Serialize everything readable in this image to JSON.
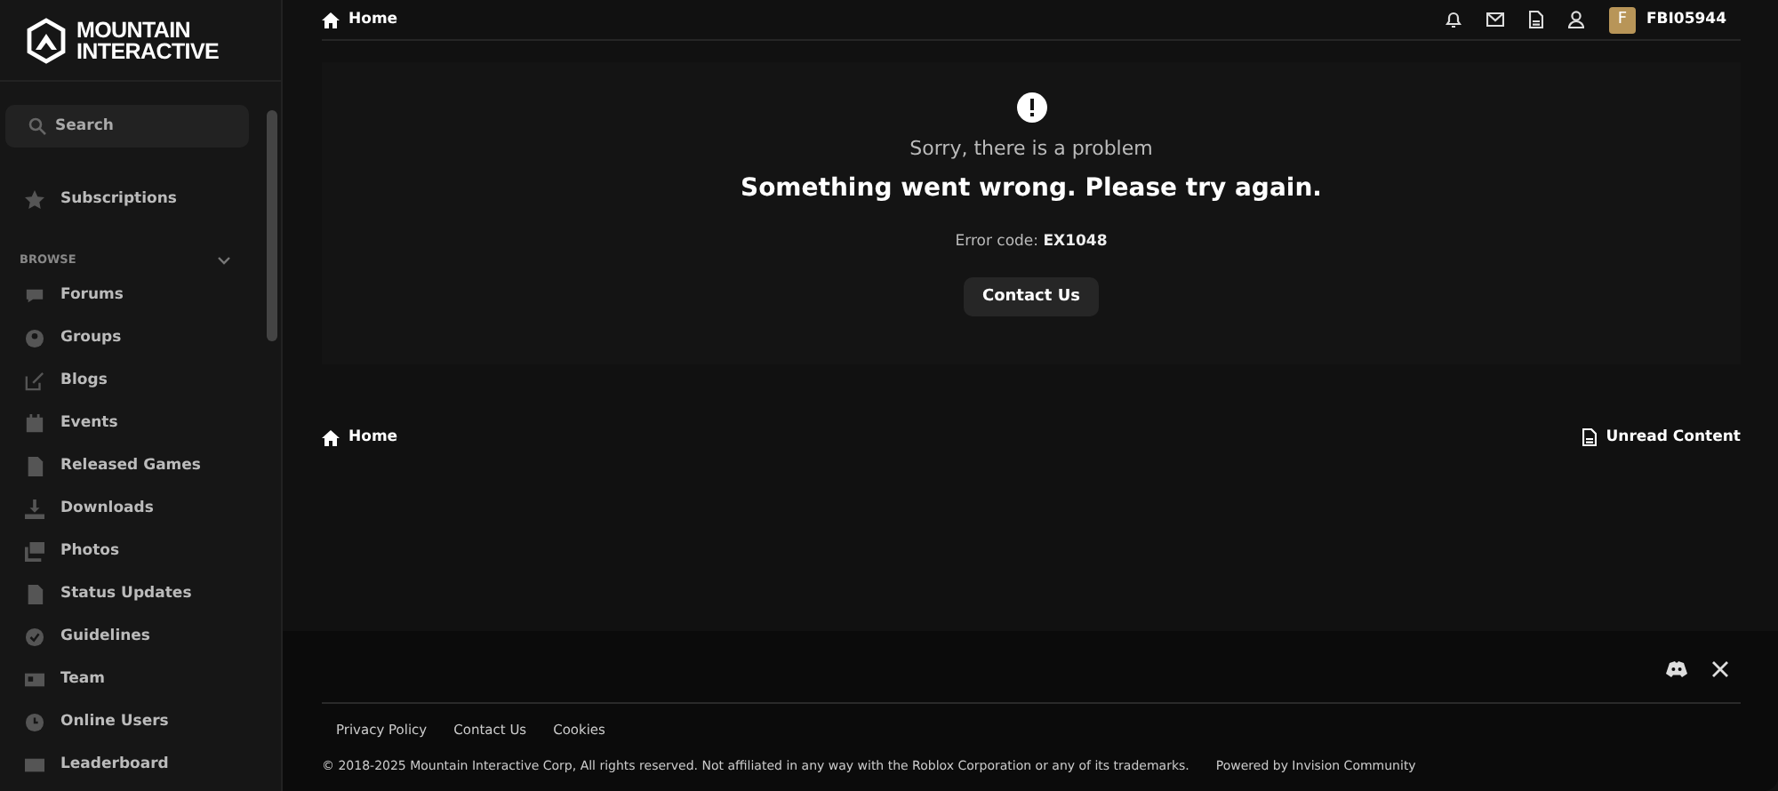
{
  "brand": {
    "line1": "MOUNTAIN",
    "line2": "INTERACTIVE"
  },
  "sidebar": {
    "search": {
      "placeholder": "Search"
    },
    "subscriptions": "Subscriptions",
    "section": {
      "title": "BROWSE",
      "expanded": true
    },
    "items": [
      {
        "label": "Forums"
      },
      {
        "label": "Groups"
      },
      {
        "label": "Blogs"
      },
      {
        "label": "Events"
      },
      {
        "label": "Released Games"
      },
      {
        "label": "Downloads"
      },
      {
        "label": "Photos"
      },
      {
        "label": "Status Updates"
      },
      {
        "label": "Guidelines"
      },
      {
        "label": "Team"
      },
      {
        "label": "Online Users"
      },
      {
        "label": "Leaderboard"
      }
    ]
  },
  "top_bar": {
    "breadcrumb": "Home",
    "avatar_letter": "F",
    "username": "FBI05944"
  },
  "error": {
    "subtitle": "Sorry, there is a problem",
    "title": "Something went wrong. Please try again.",
    "code_label": "Error code:",
    "code": "EX1048",
    "button": "Contact Us"
  },
  "bottom_bar": {
    "breadcrumb": "Home",
    "unread": "Unread Content"
  },
  "footer": {
    "links": [
      "Privacy Policy",
      "Contact Us",
      "Cookies"
    ],
    "copyright": "© 2018-2025 Mountain Interactive Corp, All rights reserved. Not affiliated in any way with the Roblox Corporation or any of its trademarks.",
    "powered": "Powered by Invision Community"
  }
}
